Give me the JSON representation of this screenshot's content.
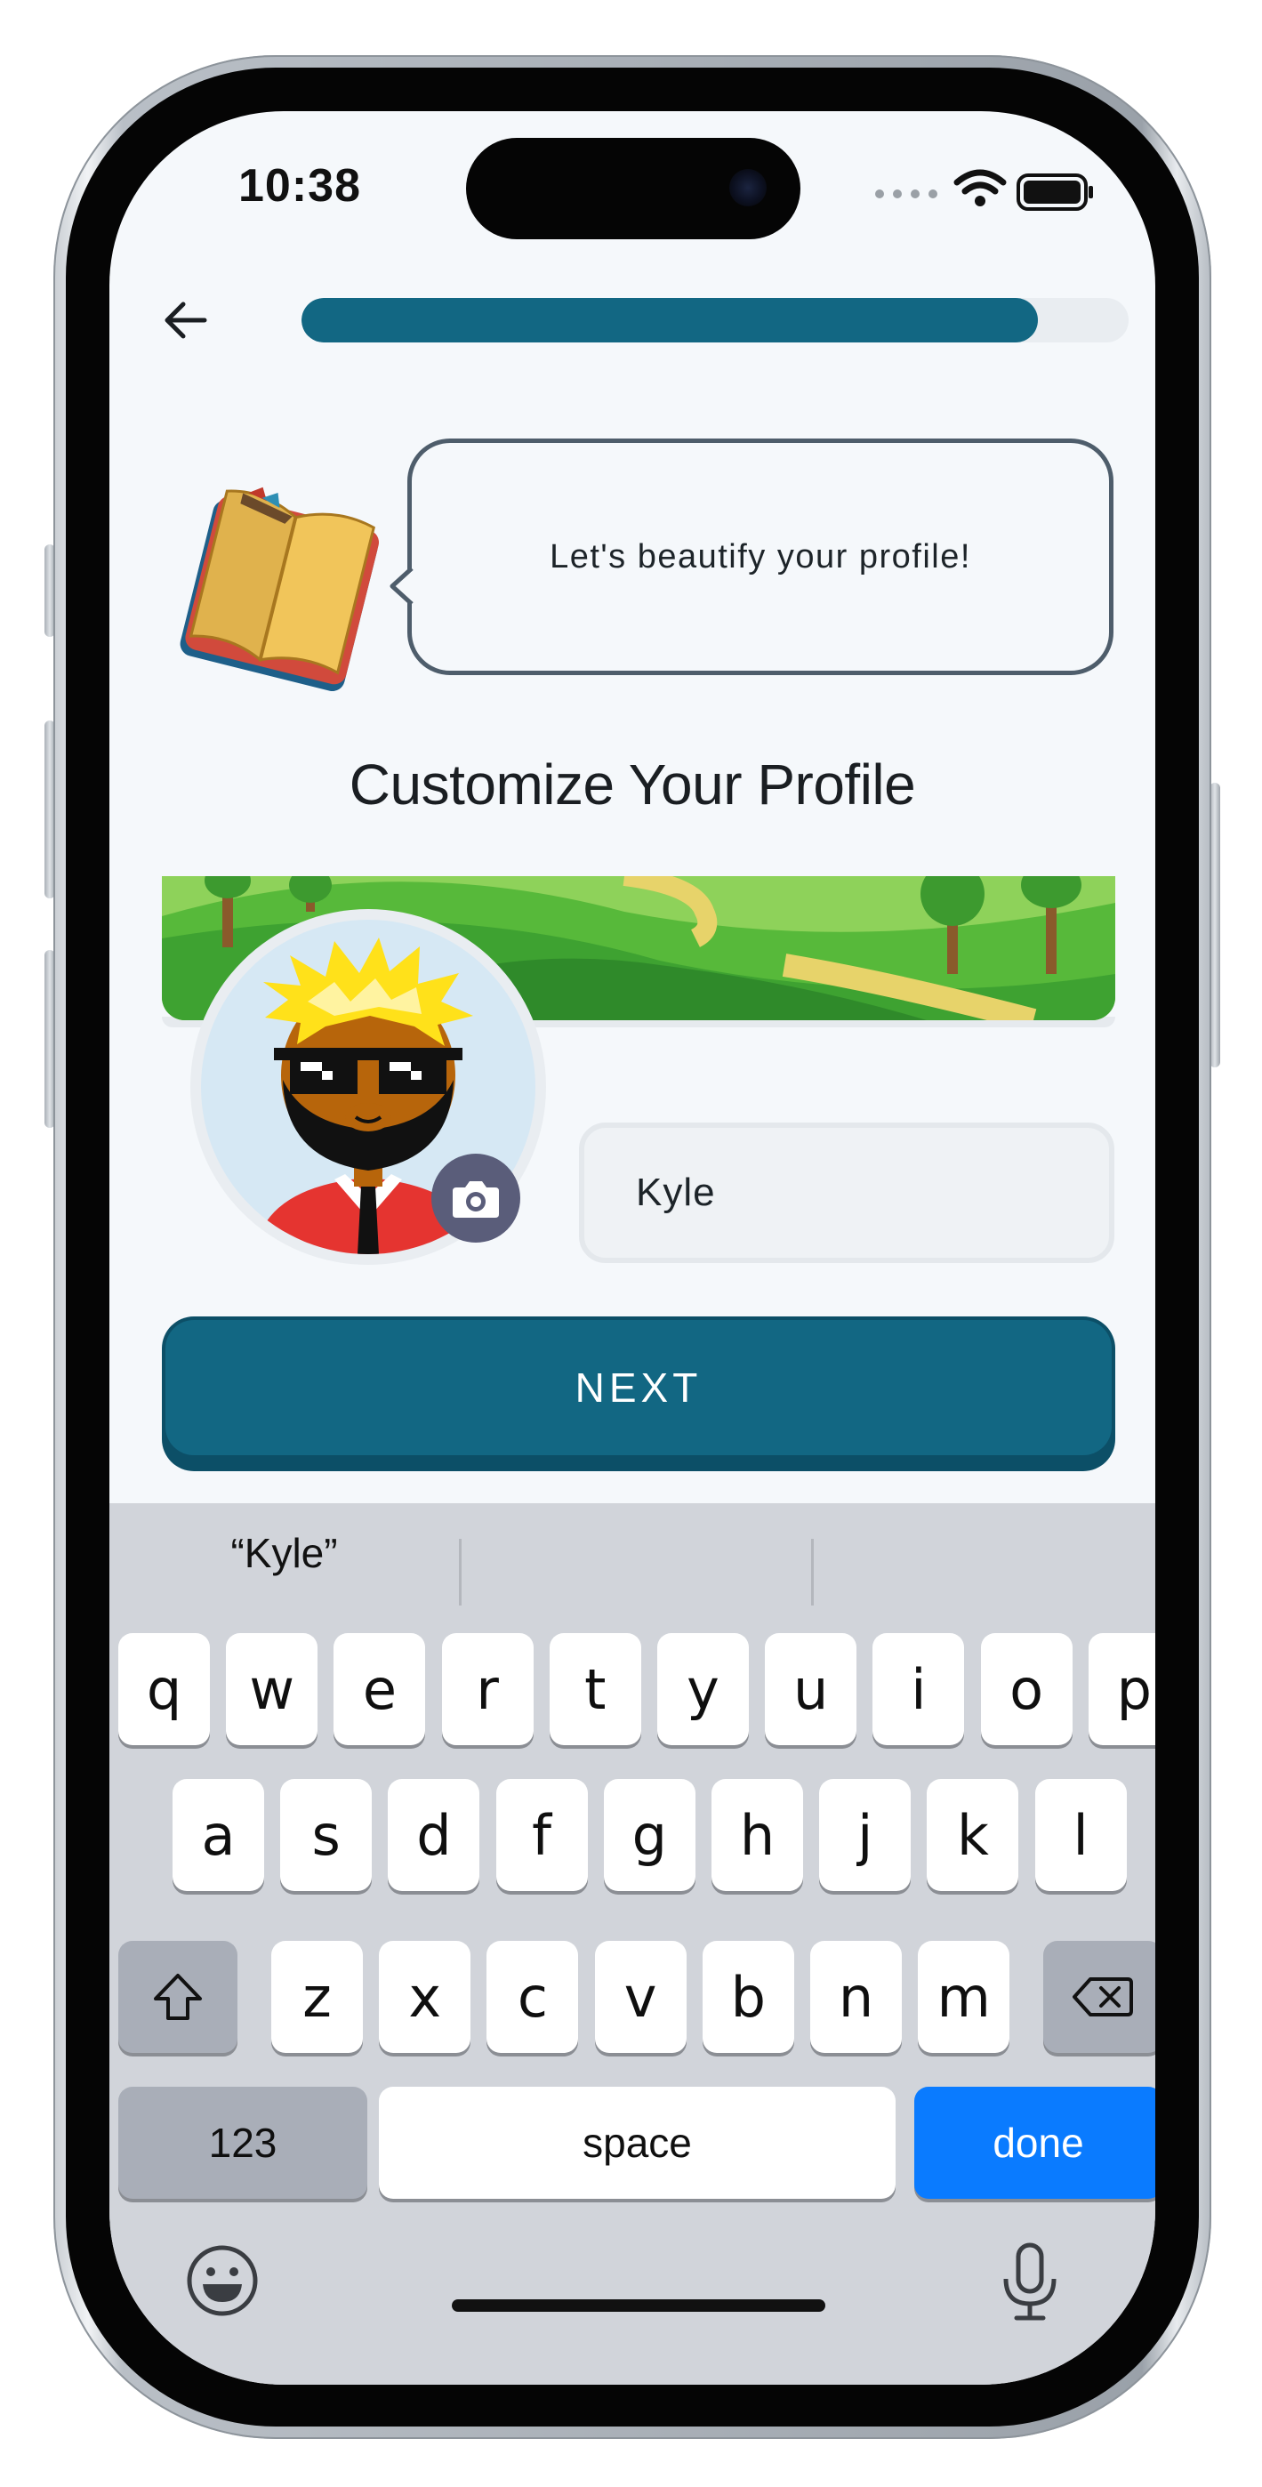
{
  "status_bar": {
    "time": "10:38"
  },
  "header": {
    "progress": 0.89
  },
  "bubble": {
    "text": "Let's beautify your profile!"
  },
  "page_title": "Customize Your Profile",
  "name_field": {
    "value": "Kyle"
  },
  "next_button": {
    "label": "NEXT"
  },
  "keyboard": {
    "suggestions": [
      "“Kyle”",
      "",
      ""
    ],
    "row1": [
      "q",
      "w",
      "e",
      "r",
      "t",
      "y",
      "u",
      "i",
      "o",
      "p"
    ],
    "row2": [
      "a",
      "s",
      "d",
      "f",
      "g",
      "h",
      "j",
      "k",
      "l"
    ],
    "row3": [
      "z",
      "x",
      "c",
      "v",
      "b",
      "n",
      "m"
    ],
    "numbers_label": "123",
    "space_label": "space",
    "done_label": "done"
  },
  "colors": {
    "accent": "#126783",
    "done_key": "#0a7bff"
  }
}
